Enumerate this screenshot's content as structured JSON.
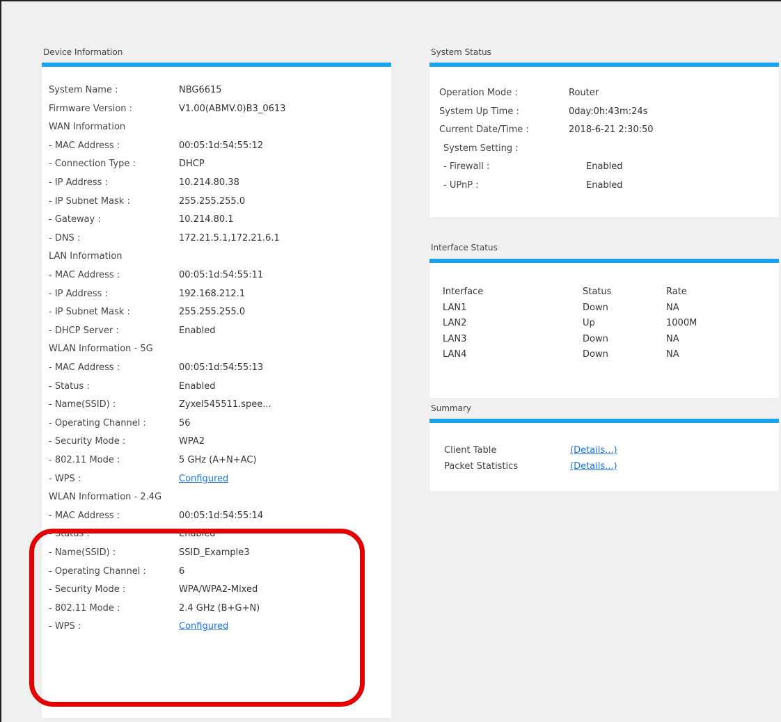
{
  "device_info": {
    "title": "Device Information",
    "rows": [
      {
        "label": "System Name :",
        "value": "NBG6615"
      },
      {
        "label": "Firmware Version :",
        "value": "V1.00(ABMV.0)B3_0613"
      },
      {
        "label": "WAN Information",
        "value": ""
      },
      {
        "label": " - MAC Address :",
        "value": "00:05:1d:54:55:12"
      },
      {
        "label": " - Connection Type :",
        "value": "DHCP"
      },
      {
        "label": " - IP Address :",
        "value": "10.214.80.38"
      },
      {
        "label": " - IP Subnet Mask :",
        "value": "255.255.255.0"
      },
      {
        "label": " - Gateway :",
        "value": "10.214.80.1"
      },
      {
        "label": " - DNS :",
        "value": "172.21.5.1,172.21.6.1"
      },
      {
        "label": "LAN Information",
        "value": ""
      },
      {
        "label": " - MAC Address :",
        "value": "00:05:1d:54:55:11"
      },
      {
        "label": " - IP Address :",
        "value": "192.168.212.1"
      },
      {
        "label": " - IP Subnet Mask :",
        "value": "255.255.255.0"
      },
      {
        "label": " - DHCP Server :",
        "value": "Enabled"
      },
      {
        "label": "WLAN Information - 5G",
        "value": ""
      },
      {
        "label": " - MAC Address :",
        "value": "00:05:1d:54:55:13"
      },
      {
        "label": " - Status :",
        "value": "Enabled"
      },
      {
        "label": " - Name(SSID) :",
        "value": "Zyxel545511.spee..."
      },
      {
        "label": " - Operating Channel :",
        "value": "56"
      },
      {
        "label": " - Security Mode :",
        "value": "WPA2"
      },
      {
        "label": " - 802.11 Mode :",
        "value": "5 GHz (A+N+AC)"
      },
      {
        "label": " - WPS :",
        "value": "Configured",
        "link": true
      },
      {
        "label": "WLAN Information - 2.4G",
        "value": ""
      },
      {
        "label": " - MAC Address :",
        "value": "00:05:1d:54:55:14"
      },
      {
        "label": " - Status :",
        "value": "Enabled"
      },
      {
        "label": " - Name(SSID) :",
        "value": "SSID_Example3"
      },
      {
        "label": " - Operating Channel :",
        "value": "6"
      },
      {
        "label": " - Security Mode :",
        "value": "WPA/WPA2-Mixed"
      },
      {
        "label": " - 802.11 Mode :",
        "value": "2.4 GHz (B+G+N)"
      },
      {
        "label": " - WPS :",
        "value": "Configured",
        "link": true
      }
    ]
  },
  "system_status": {
    "title": "System Status",
    "rows": [
      {
        "label": "Operation Mode :",
        "value": "Router"
      },
      {
        "label": "System Up Time :",
        "value": "0day:0h:43m:24s"
      },
      {
        "label": "Current Date/Time :",
        "value": "2018-6-21 2:30:50"
      },
      {
        "label": "System Setting :",
        "value": ""
      },
      {
        "label": " - Firewall :",
        "value": "Enabled"
      },
      {
        "label": " - UPnP :",
        "value": "Enabled"
      }
    ]
  },
  "interface_status": {
    "title": "Interface Status",
    "headers": [
      "Interface",
      "Status",
      "Rate"
    ],
    "rows": [
      [
        "LAN1",
        "Down",
        "NA"
      ],
      [
        "LAN2",
        "Up",
        "1000M"
      ],
      [
        "LAN3",
        "Down",
        "NA"
      ],
      [
        "LAN4",
        "Down",
        "NA"
      ]
    ]
  },
  "summary": {
    "title": "Summary",
    "rows": [
      {
        "label": "Client Table",
        "value": "(Details...)"
      },
      {
        "label": "Packet Statistics",
        "value": "(Details...)"
      }
    ]
  },
  "colors": {
    "accent": "#1aa3ec",
    "link": "#1a73e8",
    "highlight": "#e30000"
  }
}
